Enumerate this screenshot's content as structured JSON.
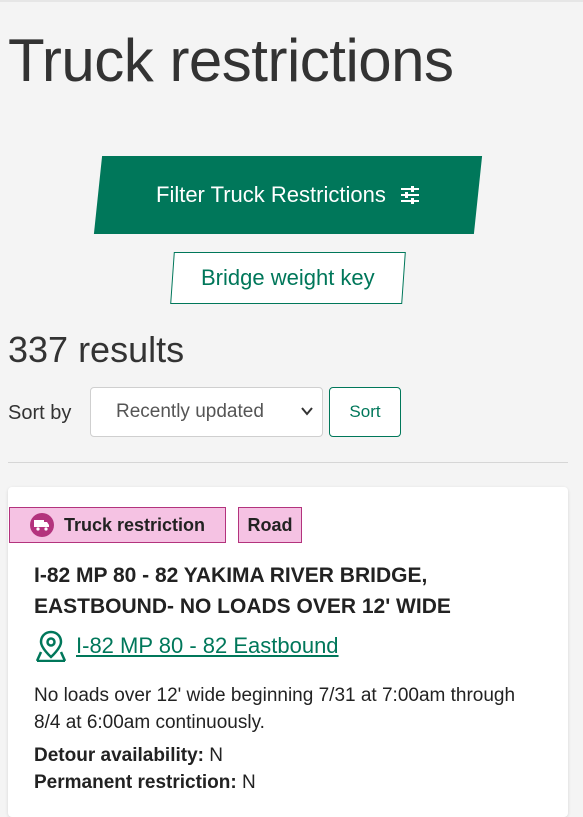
{
  "page": {
    "title": "Truck restrictions"
  },
  "actions": {
    "filter_label": "Filter Truck Restrictions",
    "bridge_key_label": "Bridge weight key"
  },
  "results": {
    "count_text": "337 results"
  },
  "sort": {
    "label": "Sort by",
    "selected": "Recently updated",
    "button_label": "Sort"
  },
  "colors": {
    "accent": "#00775a",
    "badge_bg": "#f5c2e3",
    "badge_border": "#b3337d"
  },
  "card": {
    "badges": [
      "Truck restriction",
      "Road"
    ],
    "title": "I-82 MP 80 - 82 YAKIMA RIVER BRIDGE, EASTBOUND- NO LOADS OVER 12' WIDE",
    "location_link": "I-82 MP 80 - 82 Eastbound",
    "description": "No loads over 12' wide beginning 7/31 at 7:00am through 8/4 at 6:00am continuously.",
    "fields": [
      {
        "label": "Detour availability:",
        "value": "N"
      },
      {
        "label": "Permanent restriction:",
        "value": "N"
      }
    ]
  }
}
